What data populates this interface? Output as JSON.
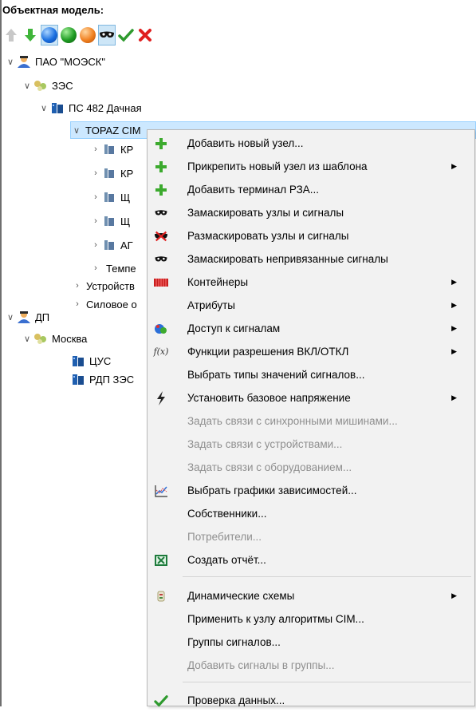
{
  "panel": {
    "title": "Объектная модель:"
  },
  "toolbar": {
    "buttons": [
      "up-arrow",
      "down-arrow",
      "blue-ball",
      "green-ball",
      "orange-ball",
      "mask",
      "check",
      "cross"
    ]
  },
  "tree": {
    "nodes": [
      {
        "label": "ПАО \"МОЭСК\""
      },
      {
        "label": "ЗЭС"
      },
      {
        "label": "ПС 482 Дачная"
      },
      {
        "label": "TOPAZ CIM"
      },
      {
        "label": "КР"
      },
      {
        "label": "КР"
      },
      {
        "label": "Щ"
      },
      {
        "label": "Щ"
      },
      {
        "label": "АГ"
      },
      {
        "label": "Темпе"
      },
      {
        "label": "Устройств"
      },
      {
        "label": "Силовое о"
      },
      {
        "label": "ДП"
      },
      {
        "label": "Москва"
      },
      {
        "label": "ЦУС"
      },
      {
        "label": "РДП ЗЭС"
      }
    ]
  },
  "context_menu": {
    "items": [
      {
        "label": "Добавить новый узел..."
      },
      {
        "label": "Прикрепить новый узел из шаблона"
      },
      {
        "label": "Добавить терминал РЗА..."
      },
      {
        "label": "Замаскировать узлы и сигналы"
      },
      {
        "label": "Размаскировать узлы и сигналы"
      },
      {
        "label": "Замаскировать непривязанные сигналы"
      },
      {
        "label": "Контейнеры"
      },
      {
        "label": "Атрибуты"
      },
      {
        "label": "Доступ к сигналам"
      },
      {
        "label": "Функции разрешения ВКЛ/ОТКЛ"
      },
      {
        "label": "Выбрать типы значений сигналов..."
      },
      {
        "label": "Установить базовое напряжение"
      },
      {
        "label": "Задать связи с синхронными мишинами..."
      },
      {
        "label": "Задать связи с устройствами..."
      },
      {
        "label": "Задать связи с оборудованием..."
      },
      {
        "label": "Выбрать графики зависимостей..."
      },
      {
        "label": "Собственники..."
      },
      {
        "label": "Потребители..."
      },
      {
        "label": "Создать отчёт..."
      },
      {
        "label": "Динамические схемы"
      },
      {
        "label": "Применить к узлу алгоритмы CIM..."
      },
      {
        "label": "Группы сигналов..."
      },
      {
        "label": "Добавить сигналы в группы..."
      },
      {
        "label": "Проверка данных..."
      }
    ]
  },
  "colors": {
    "selection": "#cce8ff",
    "menu_bg": "#f2f2f2",
    "disabled_text": "#8f8f8f"
  }
}
